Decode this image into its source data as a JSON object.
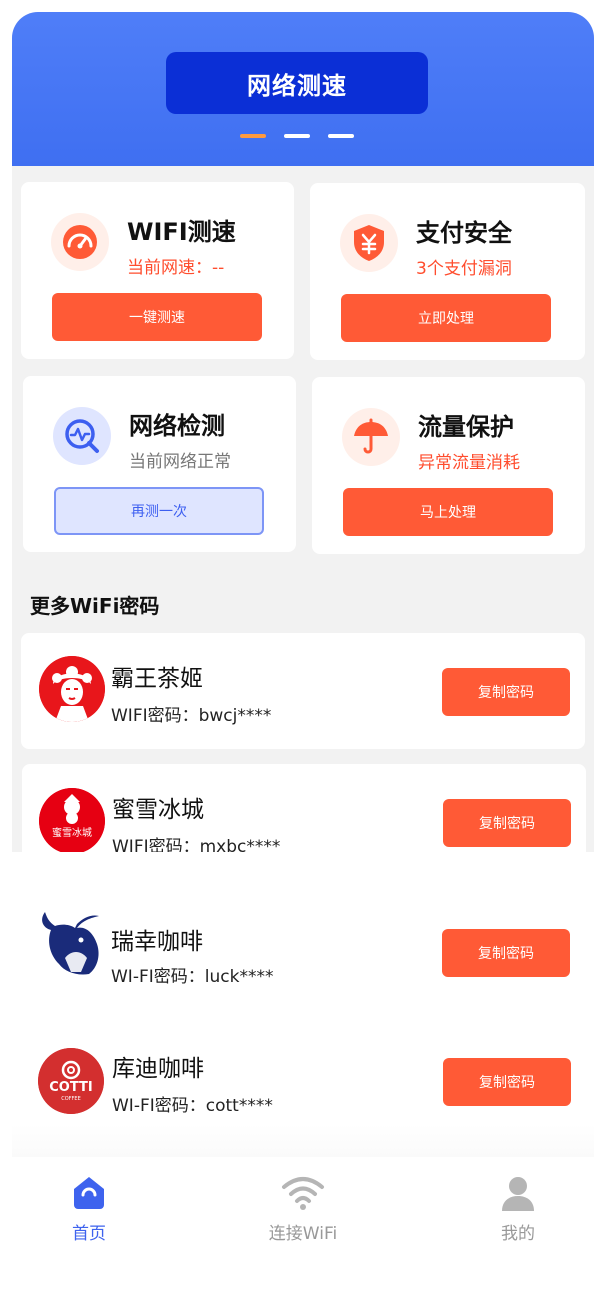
{
  "banner": {
    "title": "网络测速"
  },
  "cards": [
    {
      "title": "WIFI测速",
      "subtitle": "当前网速：--",
      "button": "一键测速",
      "icon": "speedometer-icon"
    },
    {
      "title": "支付安全",
      "subtitle": "3个支付漏洞",
      "button": "立即处理",
      "icon": "shield-yen-icon"
    },
    {
      "title": "网络检测",
      "subtitle": "当前网络正常",
      "button": "再测一次",
      "icon": "network-check-icon"
    },
    {
      "title": "流量保护",
      "subtitle": "异常流量消耗",
      "button": "马上处理",
      "icon": "umbrella-icon"
    }
  ],
  "more": {
    "title": "更多WiFi密码",
    "items": [
      {
        "name": "霸王茶姬",
        "password": "WIFI密码：bwcj****",
        "button": "复制密码"
      },
      {
        "name": "蜜雪冰城",
        "password": "WIFI密码：mxbc****",
        "button": "复制密码",
        "logo_text": "蜜雪冰城"
      },
      {
        "name": "瑞幸咖啡",
        "password": "WI-FI密码：luck****",
        "button": "复制密码"
      },
      {
        "name": "库迪咖啡",
        "password": "WI-FI密码：cott****",
        "button": "复制密码",
        "logo_text": "COTTI",
        "logo_subtext": "COFFEE"
      }
    ]
  },
  "tabbar": [
    {
      "label": "首页",
      "icon": "home-icon",
      "active": true
    },
    {
      "label": "连接WiFi",
      "icon": "wifi-icon",
      "active": false
    },
    {
      "label": "我的",
      "icon": "user-icon",
      "active": false
    }
  ],
  "colors": {
    "primary": "#3f6ff1",
    "accent": "#ff5a36",
    "banner_button": "#0b2fd6"
  }
}
